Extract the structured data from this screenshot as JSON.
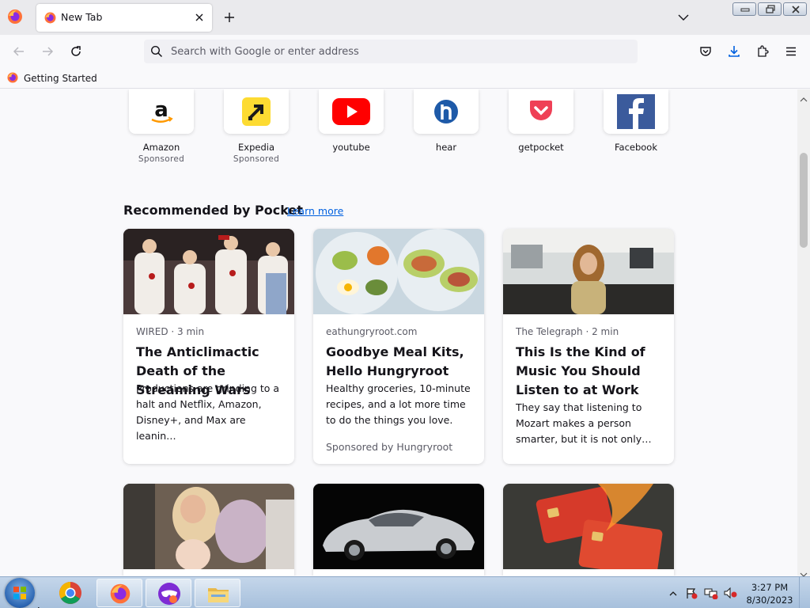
{
  "tab": {
    "title": "New Tab"
  },
  "urlbar": {
    "placeholder": "Search with Google or enter address"
  },
  "bookmarks": [
    {
      "label": "Getting Started"
    }
  ],
  "top_sites": [
    {
      "name": "Amazon",
      "sponsored": "Sponsored"
    },
    {
      "name": "Expedia",
      "sponsored": "Sponsored"
    },
    {
      "name": "youtube"
    },
    {
      "name": "hear"
    },
    {
      "name": "getpocket"
    },
    {
      "name": "Facebook"
    }
  ],
  "pocket": {
    "heading": "Recommended by Pocket",
    "learn_more": "Learn more",
    "cards": [
      {
        "source": "WIRED · 3 min",
        "title": "The Anticlimactic Death of the Streaming Wars",
        "excerpt": "Productions are grinding to a halt and Netflix, Amazon, Disney+, and Max are leanin…"
      },
      {
        "source": "eathungryroot.com",
        "title": "Goodbye Meal Kits, Hello Hungryroot",
        "excerpt": "Healthy groceries, 10-minute recipes, and a lot more time to do the things you love.",
        "sponsor": "Sponsored by Hungryroot"
      },
      {
        "source": "The Telegraph · 2 min",
        "title": "This Is the Kind of Music You Should Listen to at Work",
        "excerpt": "They say that listening to Mozart makes a person smarter, but it is not only…"
      }
    ]
  },
  "taskbar": {
    "time": "3:27 PM",
    "date": "8/30/2023"
  },
  "colors": {
    "accent": "#0060df",
    "page_bg": "#f9f9fb",
    "tabstrip_bg": "#eaeaed"
  }
}
